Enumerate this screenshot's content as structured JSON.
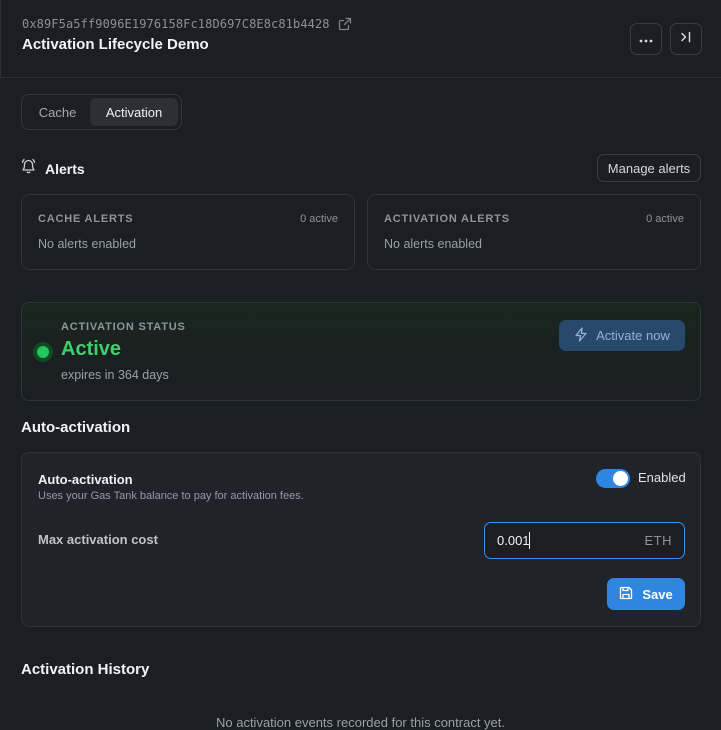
{
  "header": {
    "contract_address": "0x89F5a5ff9096E1976158Fc18D697C8E8c81b4428",
    "title": "Activation Lifecycle Demo",
    "icons": {
      "external_link": "external-link-icon",
      "more": "more-horizontal-icon",
      "collapse": "collapse-panel-icon"
    }
  },
  "tabs": [
    {
      "label": "Cache",
      "active": false
    },
    {
      "label": "Activation",
      "active": true
    }
  ],
  "alerts": {
    "title": "Alerts",
    "icon": "bell-icon",
    "manage_label": "Manage alerts",
    "cards": [
      {
        "label": "CACHE ALERTS",
        "count": "0 active",
        "message": "No alerts enabled"
      },
      {
        "label": "ACTIVATION ALERTS",
        "count": "0 active",
        "message": "No alerts enabled"
      }
    ]
  },
  "status": {
    "label": "ACTIVATION STATUS",
    "value": "Active",
    "expires": "expires in 364 days",
    "activate_label": "Activate now",
    "status_color": "#22c55e",
    "activate_enabled": false
  },
  "auto_activation": {
    "section_title": "Auto-activation",
    "name": "Auto-activation",
    "description": "Uses your Gas Tank balance to pay for activation fees.",
    "toggle_on": true,
    "toggle_label": "Enabled",
    "max_cost_label": "Max activation cost",
    "max_cost_value": "0.001",
    "max_cost_unit": "ETH",
    "save_label": "Save"
  },
  "history": {
    "title": "Activation History",
    "empty_message": "No activation events recorded for this contract yet."
  },
  "colors": {
    "background": "#1b1e23",
    "accent": "#2f86e0",
    "success": "#3fcf6e"
  }
}
